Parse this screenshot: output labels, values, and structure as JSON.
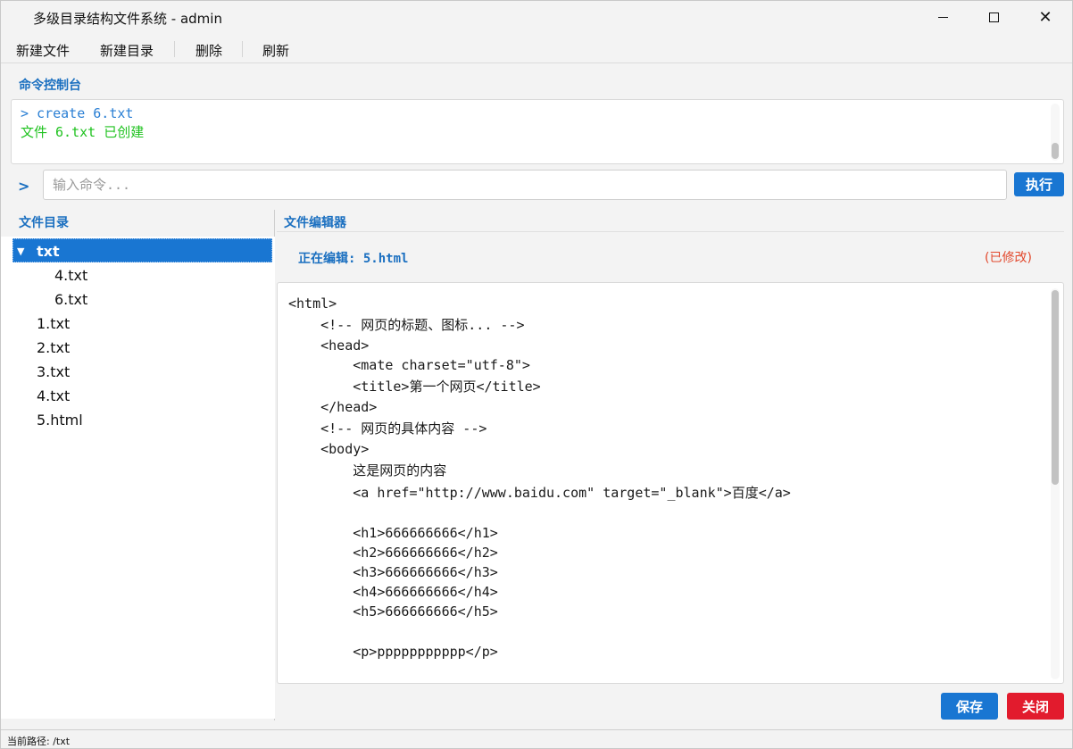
{
  "window": {
    "title": "多级目录结构文件系统 - admin",
    "controls": {
      "minimize": "",
      "maximize": "",
      "close": "✕"
    }
  },
  "menu": {
    "items": [
      "新建文件",
      "新建目录",
      "删除",
      "刷新"
    ]
  },
  "console": {
    "label": "命令控制台",
    "lines": [
      {
        "text": "> create 6.txt",
        "color": "#2a7fd4"
      },
      {
        "text": "文件 6.txt 已创建",
        "color": "#1fc21f"
      }
    ],
    "prompt": ">",
    "input_value": "",
    "input_placeholder": "输入命令...",
    "execute_label": "执行"
  },
  "tree": {
    "label": "文件目录",
    "items": [
      {
        "label": "txt",
        "type": "folder",
        "expanded": true,
        "selected": true,
        "depth": 0
      },
      {
        "label": "4.txt",
        "type": "file",
        "depth": 1
      },
      {
        "label": "6.txt",
        "type": "file",
        "depth": 1
      },
      {
        "label": "1.txt",
        "type": "file",
        "depth": 0
      },
      {
        "label": "2.txt",
        "type": "file",
        "depth": 0
      },
      {
        "label": "3.txt",
        "type": "file",
        "depth": 0
      },
      {
        "label": "4.txt",
        "type": "file",
        "depth": 0
      },
      {
        "label": "5.html",
        "type": "file",
        "depth": 0
      }
    ]
  },
  "editor": {
    "label": "文件编辑器",
    "editing_text": "正在编辑: 5.html",
    "modified_text": "(已修改)",
    "lines": [
      "<html>",
      "    <!-- 网页的标题、图标... -->",
      "    <head>",
      "        <mate charset=\"utf-8\">",
      "        <title>第一个网页</title>",
      "    </head>",
      "    <!-- 网页的具体内容 -->",
      "    <body>",
      "        这是网页的内容",
      "        <a href=\"http://www.baidu.com\" target=\"_blank\">百度</a>",
      "",
      "        <h1>666666666</h1>",
      "        <h2>666666666</h2>",
      "        <h3>666666666</h3>",
      "        <h4>666666666</h4>",
      "        <h5>666666666</h5>",
      "",
      "        <p>ppppppppppp</p>"
    ],
    "save_label": "保存",
    "close_label": "关闭"
  },
  "status": {
    "text": "当前路径: /txt"
  },
  "colors": {
    "accent": "#1976d2",
    "danger": "#e21b2d",
    "success": "#1fc21f",
    "modified": "#e2482c"
  }
}
